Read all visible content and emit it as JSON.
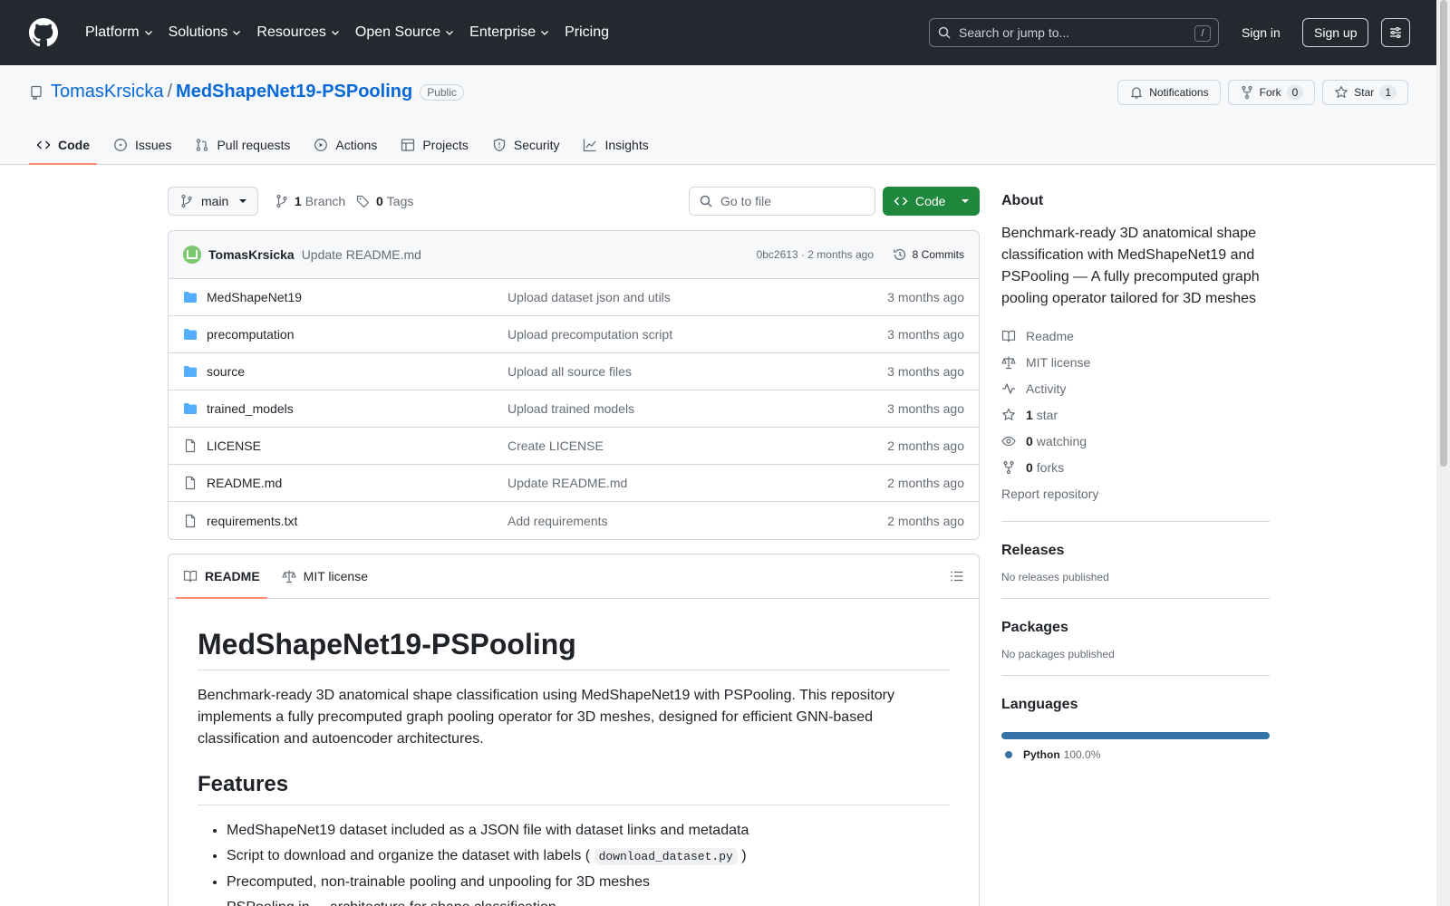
{
  "header": {
    "nav": [
      "Platform",
      "Solutions",
      "Resources",
      "Open Source",
      "Enterprise",
      "Pricing"
    ],
    "search_placeholder": "Search or jump to...",
    "search_shortcut": "/",
    "signin": "Sign in",
    "signup": "Sign up"
  },
  "repo": {
    "owner": "TomasKrsicka",
    "separator": "/",
    "name": "MedShapeNet19-PSPooling",
    "visibility": "Public",
    "notifications": "Notifications",
    "fork_label": "Fork",
    "fork_count": "0",
    "star_label": "Star",
    "star_count": "1"
  },
  "tabs": [
    "Code",
    "Issues",
    "Pull requests",
    "Actions",
    "Projects",
    "Security",
    "Insights"
  ],
  "toolbar": {
    "branch": "main",
    "branches_count": "1",
    "branches_label": "Branch",
    "tags_count": "0",
    "tags_label": "Tags",
    "goto_placeholder": "Go to file",
    "code_button": "Code"
  },
  "commit": {
    "author": "TomasKrsicka",
    "message": "Update README.md",
    "sha_time": "0bc2613 · 2 months ago",
    "commits": "8 Commits"
  },
  "files": [
    {
      "type": "dir",
      "name": "MedShapeNet19",
      "message": "Upload dataset json and utils",
      "time": "3 months ago"
    },
    {
      "type": "dir",
      "name": "precomputation",
      "message": "Upload precomputation script",
      "time": "3 months ago"
    },
    {
      "type": "dir",
      "name": "source",
      "message": "Upload all source files",
      "time": "3 months ago"
    },
    {
      "type": "dir",
      "name": "trained_models",
      "message": "Upload trained models",
      "time": "3 months ago"
    },
    {
      "type": "file",
      "name": "LICENSE",
      "message": "Create LICENSE",
      "time": "2 months ago"
    },
    {
      "type": "file",
      "name": "README.md",
      "message": "Update README.md",
      "time": "2 months ago"
    },
    {
      "type": "file",
      "name": "requirements.txt",
      "message": "Add requirements",
      "time": "2 months ago"
    }
  ],
  "readme": {
    "tab_readme": "README",
    "tab_license": "MIT license",
    "title": "MedShapeNet19-PSPooling",
    "intro": "Benchmark-ready 3D anatomical shape classification using MedShapeNet19 with PSPooling. This repository implements a fully precomputed graph pooling operator for 3D meshes, designed for efficient GNN-based classification and autoencoder architectures.",
    "features_heading": "Features",
    "feature_1": "MedShapeNet19 dataset included as a JSON file with dataset links and metadata",
    "feature_2_pre": "Script to download and organize the dataset with labels (",
    "feature_2_code": "download_dataset.py",
    "feature_2_post": ")",
    "feature_3": "Precomputed, non-trainable pooling and unpooling for 3D meshes",
    "feature_4": "PSPooling in ... architecture for shape classification"
  },
  "about": {
    "heading": "About",
    "description": "Benchmark-ready 3D anatomical shape classification with MedShapeNet19 and PSPooling — A fully precomputed graph pooling operator tailored for 3D meshes",
    "readme": "Readme",
    "license": "MIT license",
    "activity": "Activity",
    "stars_count": "1",
    "stars_label": "star",
    "watching_count": "0",
    "watching_label": "watching",
    "forks_count": "0",
    "forks_label": "forks",
    "report": "Report repository"
  },
  "releases": {
    "heading": "Releases",
    "note": "No releases published"
  },
  "packages": {
    "heading": "Packages",
    "note": "No packages published"
  },
  "languages": {
    "heading": "Languages",
    "name": "Python",
    "percent": "100.0%",
    "color": "#3572A5"
  }
}
